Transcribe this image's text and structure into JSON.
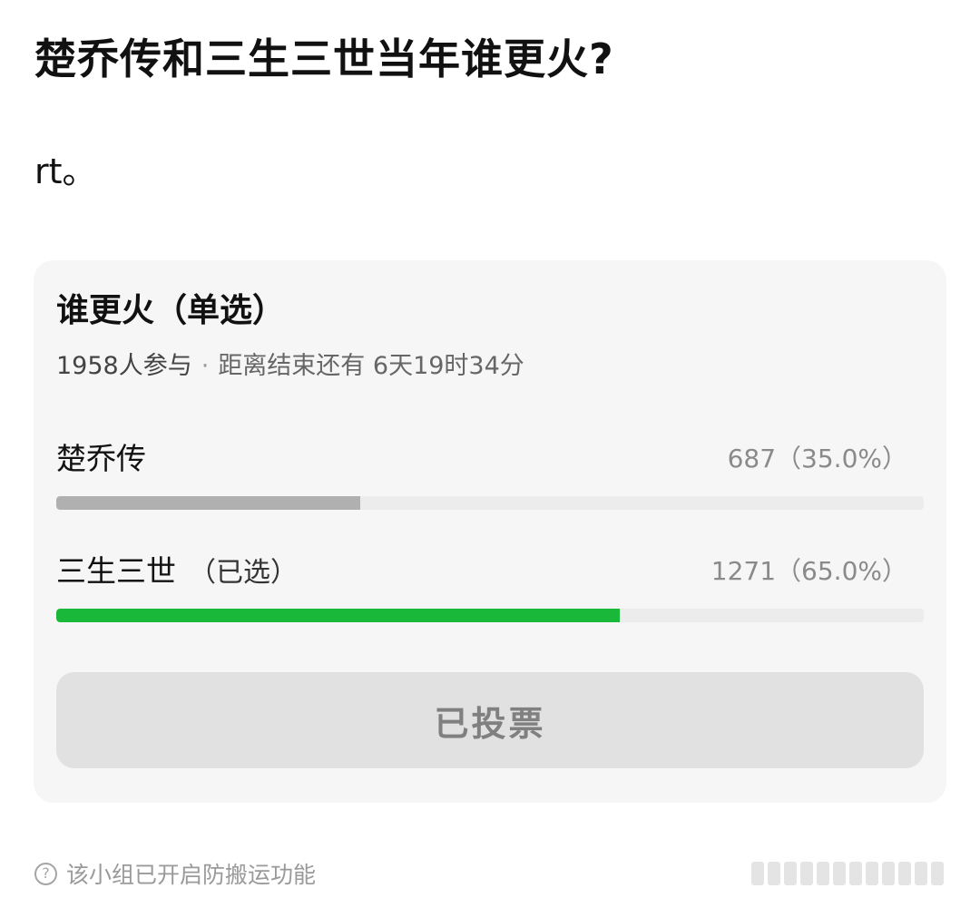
{
  "post": {
    "title": "楚乔传和三生三世当年谁更火?",
    "body": "rt。"
  },
  "poll": {
    "title": "谁更火（单选）",
    "participants": "1958人参与",
    "separator": "·",
    "remaining": "距离结束还有 6天19时34分",
    "options": [
      {
        "label": "楚乔传",
        "selected_tag": "",
        "stat": "687（35.0%）",
        "percent": 35.0,
        "selected": false
      },
      {
        "label": "三生三世",
        "selected_tag": "（已选）",
        "stat": "1271（65.0%）",
        "percent": 65.0,
        "selected": true
      }
    ],
    "vote_button_label": "已投票"
  },
  "footer": {
    "help_icon_glyph": "?",
    "notice": "该小组已开启防搬运功能"
  },
  "colors": {
    "selected_bar": "#1ab83a",
    "unselected_bar": "#b0b0b0",
    "bar_track": "#ececec",
    "card_background": "#f6f6f6"
  }
}
